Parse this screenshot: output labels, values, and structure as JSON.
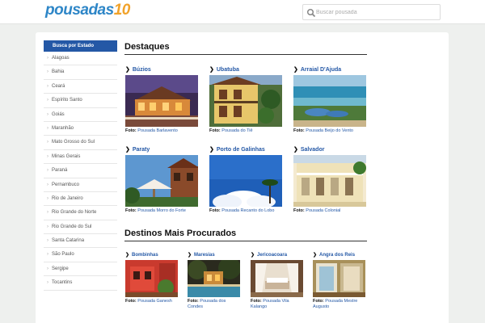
{
  "header": {
    "logo_main": "pousadas",
    "logo_num": "10",
    "search_placeholder": "Buscar pousada"
  },
  "sidebar": {
    "title": "Busca por Estado",
    "items": [
      "Alagoas",
      "Bahia",
      "Ceará",
      "Espírito Santo",
      "Goiás",
      "Maranhão",
      "Mato Grosso do Sul",
      "Minas Gerais",
      "Paraná",
      "Pernambuco",
      "Rio de Janeiro",
      "Rio Grande do Norte",
      "Rio Grande do Sul",
      "Santa Catarina",
      "São Paulo",
      "Sergipe",
      "Tocantins"
    ]
  },
  "highlights": {
    "title": "Destaques",
    "caption_label": "Foto:",
    "items": [
      {
        "name": "Búzios",
        "caption": "Pousada Barlavento"
      },
      {
        "name": "Ubatuba",
        "caption": "Pousada do Tiê"
      },
      {
        "name": "Arraial D'Ajuda",
        "caption": "Pousada Beijo do Vento"
      },
      {
        "name": "Paraty",
        "caption": "Pousada Morro do Forte"
      },
      {
        "name": "Porto de Galinhas",
        "caption": "Pousada Recanto do Lobo"
      },
      {
        "name": "Salvador",
        "caption": "Pousada Colonial"
      }
    ]
  },
  "popular": {
    "title": "Destinos Mais Procurados",
    "caption_label": "Foto:",
    "items": [
      {
        "name": "Bombinhas",
        "caption": "Pousada Ganesh"
      },
      {
        "name": "Maresias",
        "caption": "Pousada dos Condes"
      },
      {
        "name": "Jericoacoara",
        "caption": "Pousada Vila Kalango"
      },
      {
        "name": "Angra dos Reis",
        "caption": "Pousada Mestre Augusto"
      }
    ]
  },
  "icons": {
    "search": "search-icon",
    "chevron": "chevron-right-icon",
    "arrow": "arrow-right-icon"
  }
}
